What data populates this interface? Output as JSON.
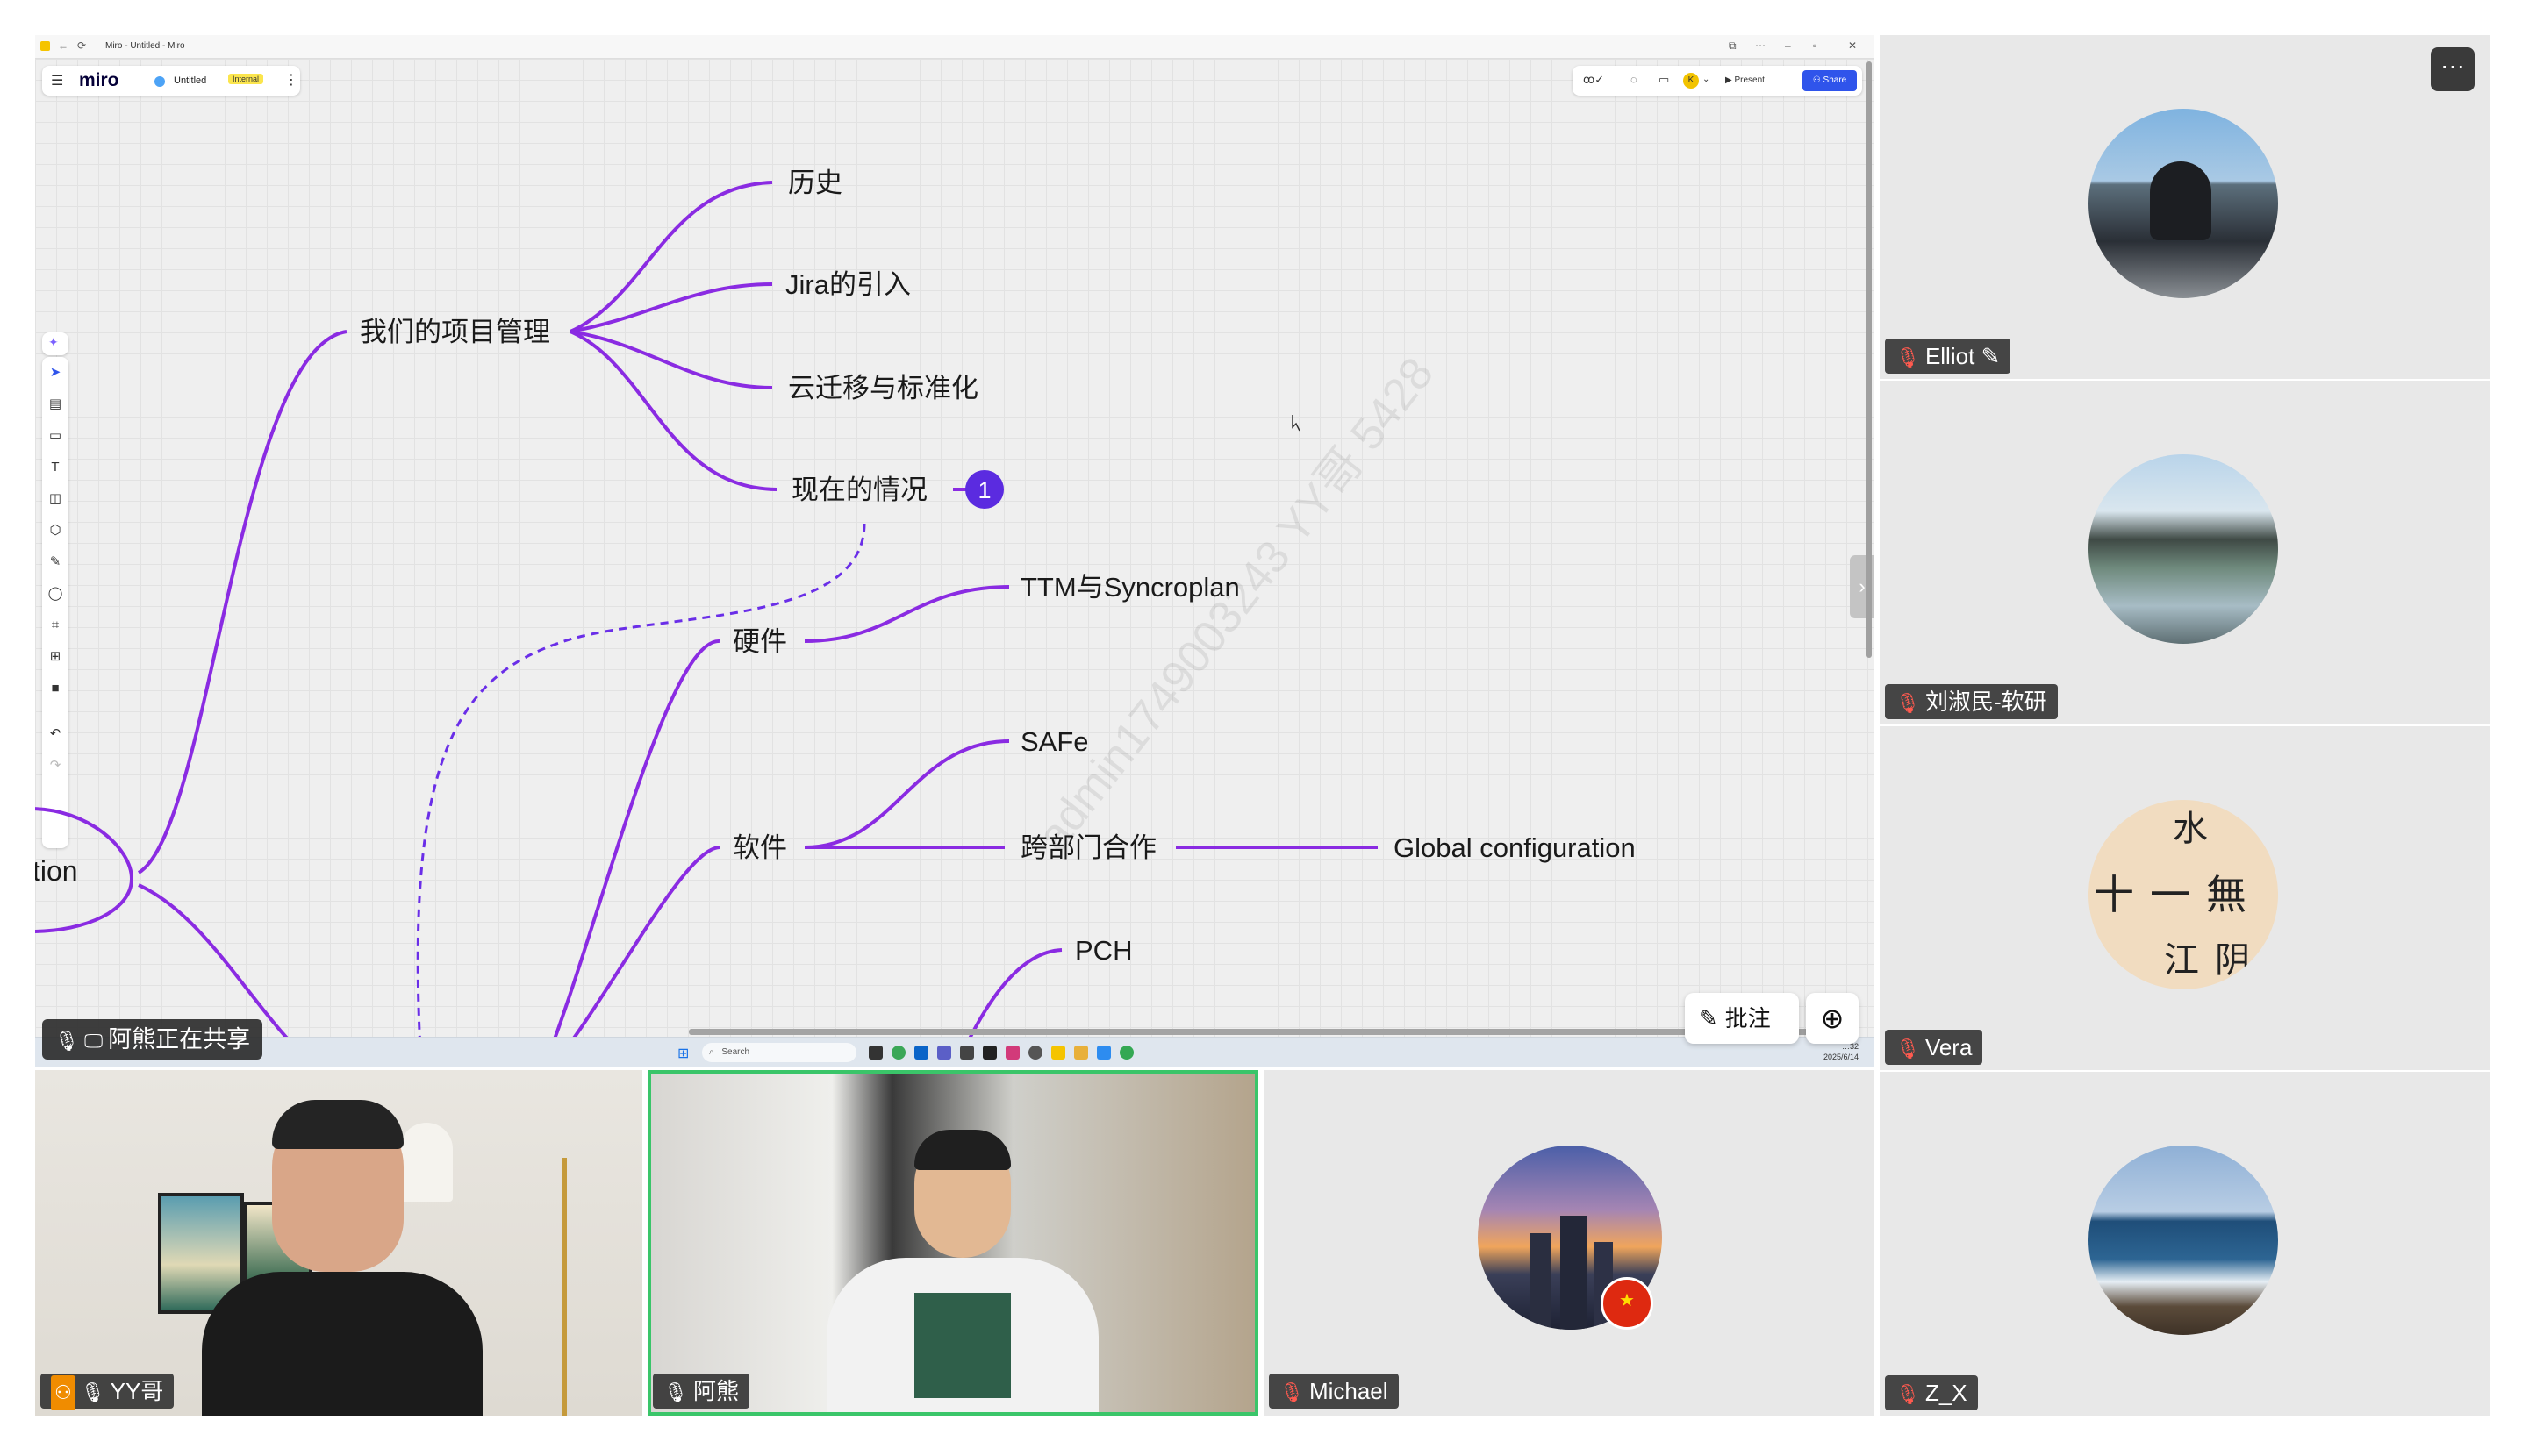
{
  "window": {
    "title": "Miro - Untitled - Miro"
  },
  "miro": {
    "logo": "miro",
    "board_name": "Untitled",
    "badge": "Internal",
    "present": "▶ Present",
    "share": "Share",
    "user_initial": "K"
  },
  "mindmap": {
    "root_partial": "tion",
    "branch_project": "我们的项目管理",
    "history": "历史",
    "jira": "Jira的引入",
    "cloud": "云迁移与标准化",
    "current": "现在的情况",
    "comment_count": "1",
    "hardware": "硬件",
    "ttm": "TTM与Syncroplan",
    "software": "软件",
    "safe": "SAFe",
    "cross": "跨部门合作",
    "global": "Global configuration",
    "pch": "PCH"
  },
  "watermark": "admin1749003243 YY哥 5428",
  "taskbar": {
    "search": "Search",
    "time": "…32",
    "date": "2025/6/14"
  },
  "sharing": {
    "label": "阿熊正在共享"
  },
  "controls": {
    "annotate": "批注",
    "more": "···"
  },
  "participants": [
    {
      "name": "Elliot"
    },
    {
      "name": "刘淑民-软研"
    },
    {
      "name": "Vera"
    },
    {
      "name": "Z_X"
    },
    {
      "name": "YY哥"
    },
    {
      "name": "阿熊"
    },
    {
      "name": "Michael"
    }
  ],
  "calligraphy": {
    "row1": "水",
    "row2": "十一無",
    "row3": "江阴"
  },
  "colors": {
    "branch": "#8a2be2",
    "accent": "#5b2be0",
    "share_blue": "#2f54eb",
    "active_speaker": "#3ac569"
  }
}
